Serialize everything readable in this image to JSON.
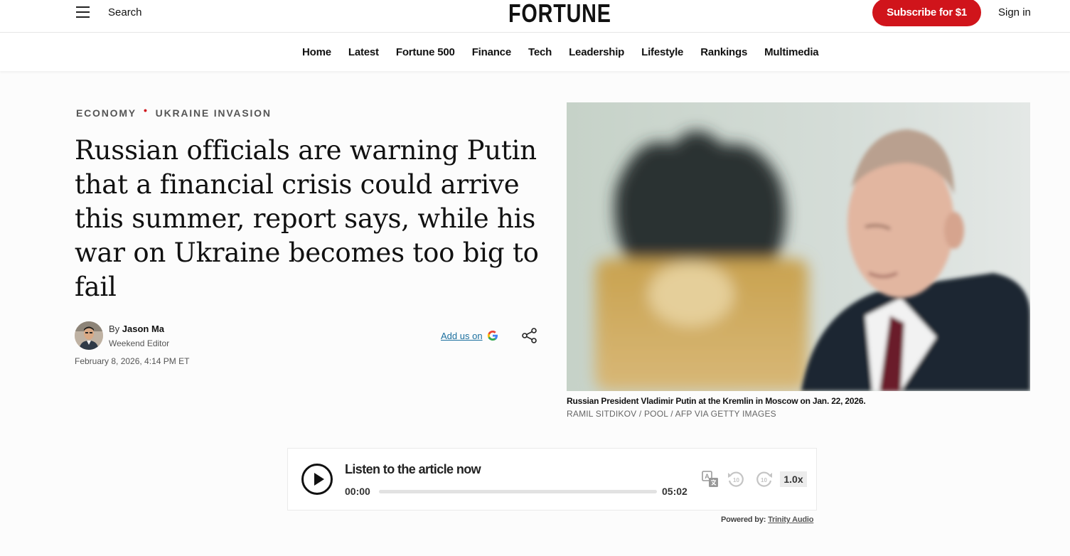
{
  "header": {
    "search_label": "Search",
    "logo": "FORTUNE",
    "subscribe_label": "Subscribe for $1",
    "signin_label": "Sign in"
  },
  "nav": {
    "items": [
      "Home",
      "Latest",
      "Fortune 500",
      "Finance",
      "Tech",
      "Leadership",
      "Lifestyle",
      "Rankings",
      "Multimedia"
    ]
  },
  "article": {
    "categories": [
      "ECONOMY",
      "UKRAINE INVASION"
    ],
    "category_separator": "•",
    "headline": "Russian officials are warning Putin that a financial crisis could arrive this summer, report says, while his war on Ukraine becomes too big to fail",
    "byline_prefix": "By",
    "author": "Jason Ma",
    "author_role": "Weekend Editor",
    "date": "February 8, 2026, 4:14 PM ET",
    "add_us_label": "Add us on",
    "add_us_icon": "google-icon",
    "image_caption": "Russian President Vladimir Putin at the Kremlin in Moscow on Jan. 22, 2026.",
    "image_credit": "RAMIL SITDIKOV / POOL / AFP VIA GETTY IMAGES"
  },
  "audio_player": {
    "title": "Listen to the article now",
    "current_time": "00:00",
    "total_time": "05:02",
    "progress": 0,
    "speed": "1.0x",
    "skip_seconds": "10",
    "powered_by_label": "Powered by:",
    "powered_by_brand": "Trinity Audio"
  },
  "colors": {
    "brand_red": "#d0141b",
    "link_blue": "#1b6f9e"
  }
}
